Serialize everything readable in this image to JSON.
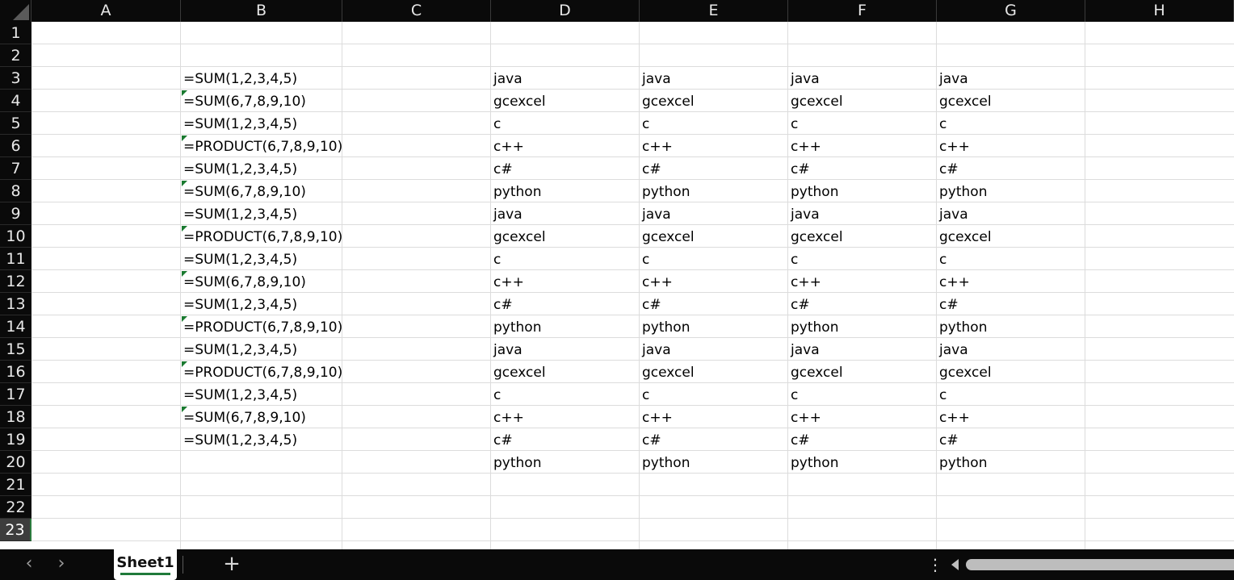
{
  "columns": [
    "A",
    "B",
    "C",
    "D",
    "E",
    "F",
    "G",
    "H"
  ],
  "rows": [
    "1",
    "2",
    "3",
    "4",
    "5",
    "6",
    "7",
    "8",
    "9",
    "10",
    "11",
    "12",
    "13",
    "14",
    "15",
    "16",
    "17",
    "18",
    "19",
    "20",
    "21",
    "22",
    "23"
  ],
  "selected_row": "23",
  "column_b": [
    {
      "row": 3,
      "text": "=SUM(1,2,3,4,5)",
      "flag": false
    },
    {
      "row": 4,
      "text": "=SUM(6,7,8,9,10)",
      "flag": true
    },
    {
      "row": 5,
      "text": "=SUM(1,2,3,4,5)",
      "flag": false
    },
    {
      "row": 6,
      "text": "=PRODUCT(6,7,8,9,10)",
      "flag": true
    },
    {
      "row": 7,
      "text": "=SUM(1,2,3,4,5)",
      "flag": false
    },
    {
      "row": 8,
      "text": "=SUM(6,7,8,9,10)",
      "flag": true
    },
    {
      "row": 9,
      "text": "=SUM(1,2,3,4,5)",
      "flag": false
    },
    {
      "row": 10,
      "text": "=PRODUCT(6,7,8,9,10)",
      "flag": true
    },
    {
      "row": 11,
      "text": "=SUM(1,2,3,4,5)",
      "flag": false
    },
    {
      "row": 12,
      "text": "=SUM(6,7,8,9,10)",
      "flag": true
    },
    {
      "row": 13,
      "text": "=SUM(1,2,3,4,5)",
      "flag": false
    },
    {
      "row": 14,
      "text": "=PRODUCT(6,7,8,9,10)",
      "flag": true
    },
    {
      "row": 15,
      "text": "=SUM(1,2,3,4,5)",
      "flag": false
    },
    {
      "row": 16,
      "text": "=PRODUCT(6,7,8,9,10)",
      "flag": true
    },
    {
      "row": 17,
      "text": "=SUM(1,2,3,4,5)",
      "flag": false
    },
    {
      "row": 18,
      "text": "=SUM(6,7,8,9,10)",
      "flag": true
    },
    {
      "row": 19,
      "text": "=SUM(1,2,3,4,5)",
      "flag": false
    }
  ],
  "language_columns": [
    "D",
    "E",
    "F",
    "G"
  ],
  "language_values": [
    {
      "row": 3,
      "text": "java"
    },
    {
      "row": 4,
      "text": "gcexcel"
    },
    {
      "row": 5,
      "text": "c"
    },
    {
      "row": 6,
      "text": "c++"
    },
    {
      "row": 7,
      "text": "c#"
    },
    {
      "row": 8,
      "text": "python"
    },
    {
      "row": 9,
      "text": "java"
    },
    {
      "row": 10,
      "text": "gcexcel"
    },
    {
      "row": 11,
      "text": "c"
    },
    {
      "row": 12,
      "text": "c++"
    },
    {
      "row": 13,
      "text": "c#"
    },
    {
      "row": 14,
      "text": "python"
    },
    {
      "row": 15,
      "text": "java"
    },
    {
      "row": 16,
      "text": "gcexcel"
    },
    {
      "row": 17,
      "text": "c"
    },
    {
      "row": 18,
      "text": "c++"
    },
    {
      "row": 19,
      "text": "c#"
    },
    {
      "row": 20,
      "text": "python"
    }
  ],
  "bottom_bar": {
    "prev_label": "‹",
    "next_label": "›",
    "sheet_tab": "Sheet1",
    "add_label": "+",
    "more_label": "⋮"
  }
}
